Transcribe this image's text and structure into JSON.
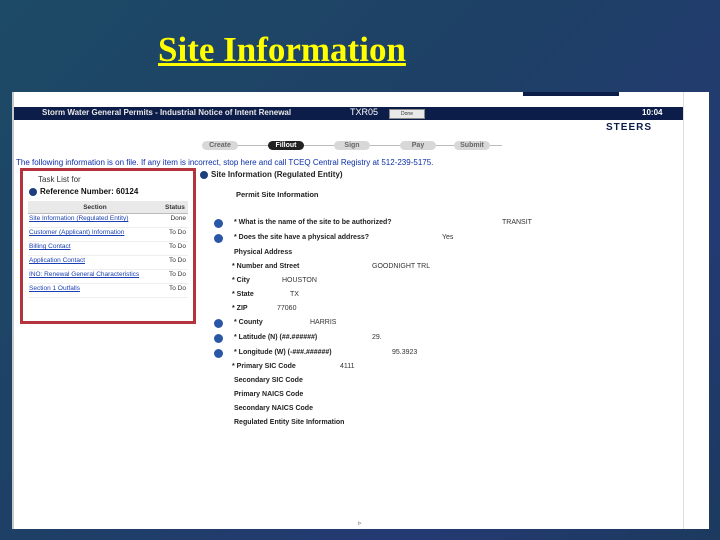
{
  "slide": {
    "title": "Site Information"
  },
  "app": {
    "title_bar": "Storm Water General Permits - Industrial Notice of Intent Renewal",
    "app_label": "TXR05",
    "button_label": "Done",
    "clock": "10:04",
    "logo": "STEERS"
  },
  "steps": [
    "Create",
    "Fillout",
    "Sign",
    "Pay",
    "Submit"
  ],
  "notice": "The following information is on file. If any item is incorrect, stop here and call TCEQ Central Registry at 512-239-5175.",
  "task_list": {
    "for_label": "Task List for",
    "reference_label": "Reference Number: 60124",
    "col_section": "Section",
    "col_status": "Status",
    "rows": [
      {
        "section": "Site Information (Regulated Entity)",
        "status": "Done"
      },
      {
        "section": "Customer (Applicant) Information",
        "status": "To Do"
      },
      {
        "section": "Billing Contact",
        "status": "To Do"
      },
      {
        "section": "Application Contact",
        "status": "To Do"
      },
      {
        "section": "INO: Renewal General Characteristics",
        "status": "To Do"
      },
      {
        "section": "Section 1 Outfalls",
        "status": "To Do"
      }
    ]
  },
  "form": {
    "heading": "Site Information (Regulated Entity)",
    "subheading": "Permit Site Information",
    "rows": [
      {
        "label": "* What is the name of the site to be authorized?",
        "value": "TRANSIT"
      },
      {
        "label": "* Does the site have a physical address?",
        "value": "Yes"
      },
      {
        "label": "Physical Address",
        "value": ""
      },
      {
        "label": "* Number and Street",
        "value": "GOODNIGHT TRL"
      },
      {
        "label": "* City",
        "value": "HOUSTON"
      },
      {
        "label": "* State",
        "value": "TX"
      },
      {
        "label": "* ZIP",
        "value": "77060"
      },
      {
        "label": "* County",
        "value": "HARRIS"
      },
      {
        "label": "* Latitude (N) (##.######)",
        "value": "29."
      },
      {
        "label": "* Longitude (W) (-###.######)",
        "value": "95.3923"
      },
      {
        "label": "* Primary SIC Code",
        "value": "4111"
      },
      {
        "label": "Secondary SIC Code",
        "value": ""
      },
      {
        "label": "Primary NAICS Code",
        "value": ""
      },
      {
        "label": "Secondary NAICS Code",
        "value": ""
      },
      {
        "label": "Regulated Entity Site Information",
        "value": ""
      }
    ]
  },
  "icons": [
    "help-icon",
    "bullet-icon"
  ]
}
